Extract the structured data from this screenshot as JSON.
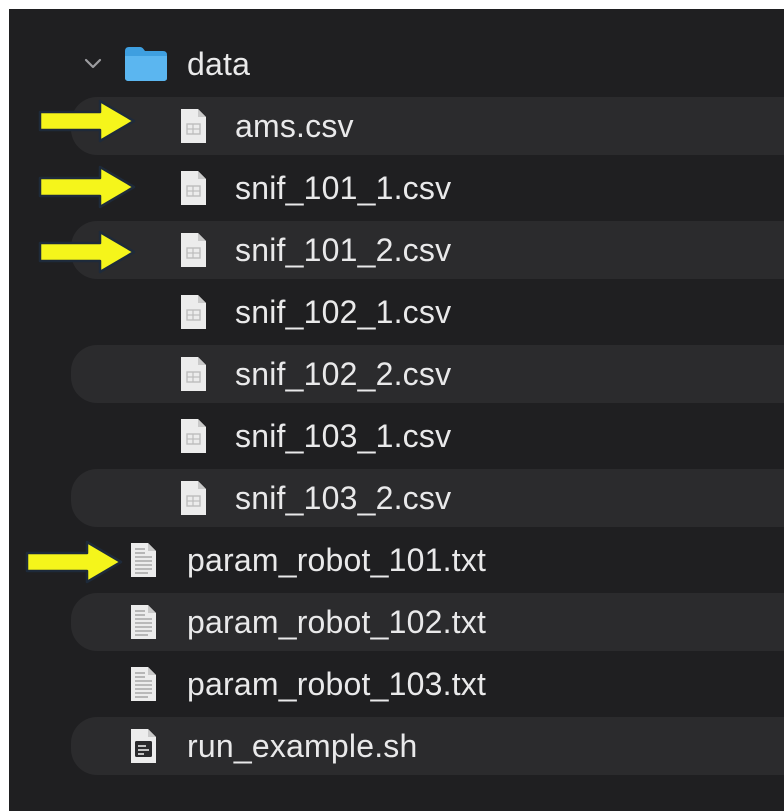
{
  "folder": {
    "name": "data",
    "icon": "folder-icon",
    "expanded": true,
    "files": [
      {
        "name": "ams.csv",
        "icon": "csv-file-icon",
        "highlighted": true
      },
      {
        "name": "snif_101_1.csv",
        "icon": "csv-file-icon",
        "highlighted": true
      },
      {
        "name": "snif_101_2.csv",
        "icon": "csv-file-icon",
        "highlighted": true
      },
      {
        "name": "snif_102_1.csv",
        "icon": "csv-file-icon",
        "highlighted": false
      },
      {
        "name": "snif_102_2.csv",
        "icon": "csv-file-icon",
        "highlighted": false
      },
      {
        "name": "snif_103_1.csv",
        "icon": "csv-file-icon",
        "highlighted": false
      },
      {
        "name": "snif_103_2.csv",
        "icon": "csv-file-icon",
        "highlighted": false
      }
    ]
  },
  "root_files": [
    {
      "name": "param_robot_101.txt",
      "icon": "text-file-icon",
      "highlighted": true
    },
    {
      "name": "param_robot_102.txt",
      "icon": "text-file-icon",
      "highlighted": false
    },
    {
      "name": "param_robot_103.txt",
      "icon": "text-file-icon",
      "highlighted": false
    },
    {
      "name": "run_example.sh",
      "icon": "shell-script-icon",
      "highlighted": false
    }
  ],
  "colors": {
    "background": "#1f1f21",
    "stripe": "#2b2b2d",
    "text": "#e9e9ea",
    "folder": "#4aa8e8",
    "arrow": "#f5f51b"
  }
}
